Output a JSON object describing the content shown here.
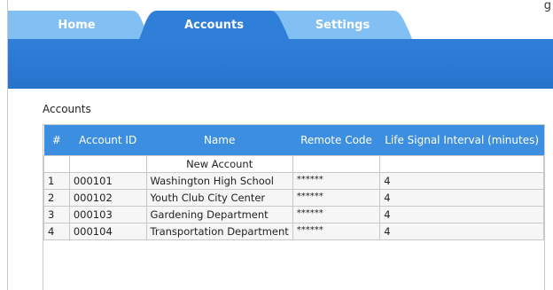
{
  "clipped_text": "g",
  "tabs": [
    {
      "label": "Home",
      "active": false
    },
    {
      "label": "Accounts",
      "active": true
    },
    {
      "label": "Settings",
      "active": false
    }
  ],
  "colors": {
    "tab_inactive": "#82bff2",
    "tab_active": "#2f7fd8",
    "header": "#3c8ee0"
  },
  "section_title": "Accounts",
  "table": {
    "columns": [
      "#",
      "Account ID",
      "Name",
      "Remote Code",
      "Life Signal Interval (minutes)"
    ],
    "new_row": {
      "label": "New Account"
    },
    "rows": [
      {
        "index": "1",
        "account_id": "000101",
        "name": "Washington High School",
        "remote_code": "******",
        "interval": "4"
      },
      {
        "index": "2",
        "account_id": "000102",
        "name": "Youth Club City Center",
        "remote_code": "******",
        "interval": "4"
      },
      {
        "index": "3",
        "account_id": "000103",
        "name": "Gardening Department",
        "remote_code": "******",
        "interval": "4"
      },
      {
        "index": "4",
        "account_id": "000104",
        "name": "Transportation Department",
        "remote_code": "******",
        "interval": "4"
      }
    ]
  }
}
